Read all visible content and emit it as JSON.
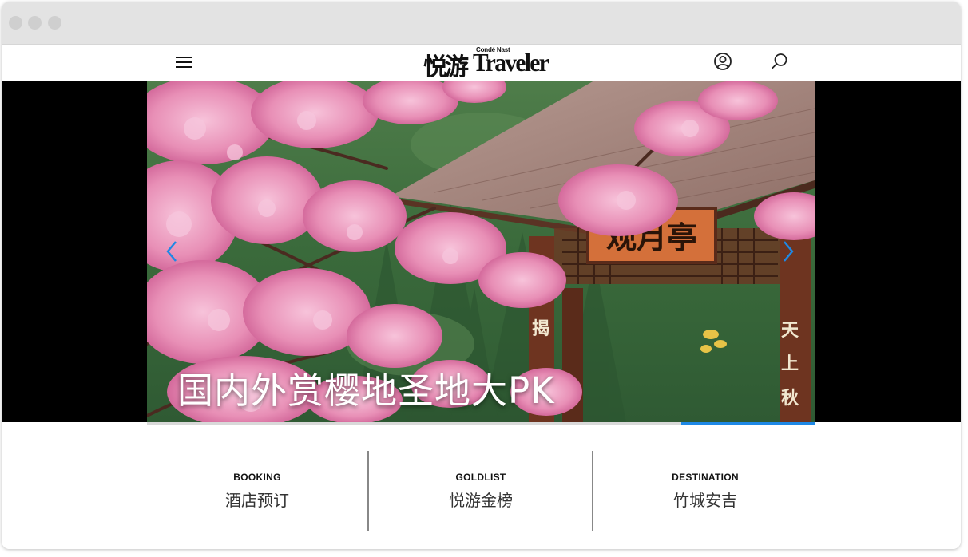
{
  "header": {
    "logo_cn": "悦游",
    "logo_small": "Condé Nast",
    "logo_en": "Traveler"
  },
  "icons": [
    "menu-icon",
    "user-icon",
    "search-icon",
    "chevron-left-icon",
    "chevron-right-icon"
  ],
  "carousel": {
    "title": "国内外赏樱地圣地大PK",
    "plaque_text": "观月亭",
    "couplet_left": "揭",
    "couplet_right": [
      "天",
      "上",
      "秋"
    ],
    "progress": 0.2
  },
  "links": [
    {
      "en": "BOOKING",
      "cn": "酒店预订"
    },
    {
      "en": "GOLDLIST",
      "cn": "悦游金榜"
    },
    {
      "en": "DESTINATION",
      "cn": "竹城安吉"
    }
  ],
  "colors": {
    "accent": "#1e88e5",
    "blossom": "#e88fb6",
    "foliage": "#3c6a3e",
    "wood": "#6e3420"
  }
}
